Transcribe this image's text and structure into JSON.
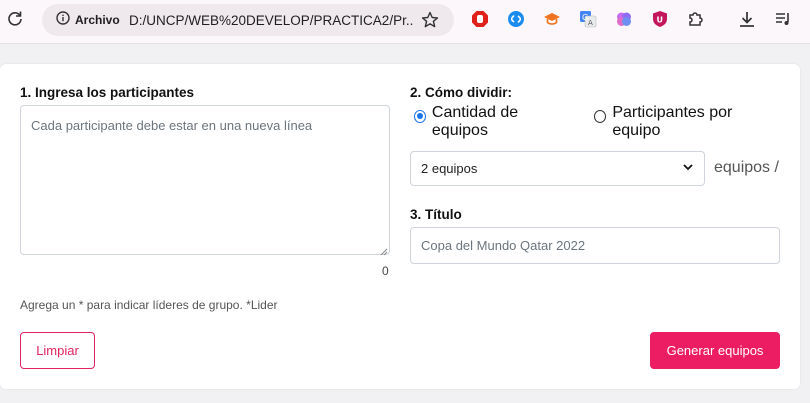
{
  "browser": {
    "site_chip_label": "Archivo",
    "url": "D:/UNCP/WEB%20DEVELOP/PRACTICA2/Pr...",
    "colors": {
      "toolbar_bg": "#fcf7fa",
      "omnibox_bg": "#efe8ed"
    },
    "extensions": [
      "adblock-icon",
      "shazam-icon",
      "graduation-cap-icon",
      "google-translate-icon",
      "brain-icon",
      "ublock-icon",
      "extensions-puzzle-icon"
    ],
    "right_icons": [
      "download-icon",
      "reading-list-icon"
    ]
  },
  "form": {
    "participants": {
      "label": "1. Ingresa los participantes",
      "placeholder": "Cada participante debe estar en una nueva línea",
      "count": "0",
      "hint": "Agrega un * para indicar líderes de grupo. *Lider"
    },
    "divide": {
      "label": "2. Cómo dividir:",
      "option_teams": "Cantidad de equipos",
      "option_per_team": "Participantes por equipo",
      "selected_option": "teams",
      "select_value": "2 equipos",
      "suffix": "equipos /"
    },
    "title": {
      "label": "3. Título",
      "placeholder": "Copa del Mundo Qatar 2022"
    },
    "buttons": {
      "clear": "Limpiar",
      "generate": "Generar equipos"
    },
    "colors": {
      "accent": "#ec1d63",
      "radio_checked": "#1a73e8"
    }
  }
}
